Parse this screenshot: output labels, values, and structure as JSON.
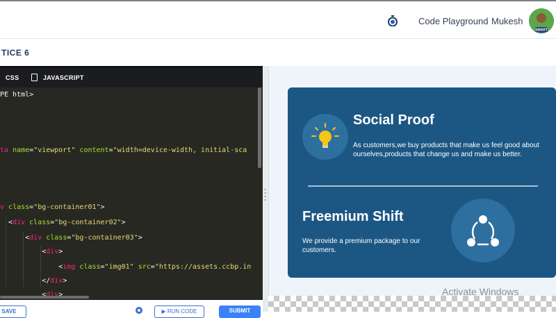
{
  "header": {
    "nav_link": "Code Playground",
    "user_name": "Mukesh",
    "avatar_badge": "SMART"
  },
  "page": {
    "title": "TICE 6"
  },
  "editor": {
    "tabs": [
      "CSS",
      "JAVASCRIPT"
    ],
    "code_lines": [
      [
        {
          "c": "t",
          "v": "PE html>"
        }
      ],
      [],
      [],
      [],
      [
        {
          "c": "g",
          "v": "ta "
        },
        {
          "c": "a",
          "v": "name"
        },
        {
          "c": "t",
          "v": "="
        },
        {
          "c": "s",
          "v": "\"viewport\""
        },
        {
          "c": "t",
          "v": " "
        },
        {
          "c": "a",
          "v": "content"
        },
        {
          "c": "t",
          "v": "="
        },
        {
          "c": "s",
          "v": "\"width=device-width, initial-sca"
        }
      ],
      [],
      [],
      [],
      [
        {
          "c": "g",
          "v": "v "
        },
        {
          "c": "a",
          "v": "class"
        },
        {
          "c": "t",
          "v": "="
        },
        {
          "c": "s",
          "v": "\"bg-container01\""
        },
        {
          "c": "t",
          "v": ">"
        }
      ],
      [
        {
          "c": "t",
          "v": "  <"
        },
        {
          "c": "g",
          "v": "div "
        },
        {
          "c": "a",
          "v": "class"
        },
        {
          "c": "t",
          "v": "="
        },
        {
          "c": "s",
          "v": "\"bg-container02\""
        },
        {
          "c": "t",
          "v": ">"
        }
      ],
      [
        {
          "c": "t",
          "v": "      <"
        },
        {
          "c": "g",
          "v": "div "
        },
        {
          "c": "a",
          "v": "class"
        },
        {
          "c": "t",
          "v": "="
        },
        {
          "c": "s",
          "v": "\"bg-container03\""
        },
        {
          "c": "t",
          "v": ">"
        }
      ],
      [
        {
          "c": "t",
          "v": "          <"
        },
        {
          "c": "g",
          "v": "div"
        },
        {
          "c": "t",
          "v": ">"
        }
      ],
      [
        {
          "c": "t",
          "v": "              <"
        },
        {
          "c": "g",
          "v": "img "
        },
        {
          "c": "a",
          "v": "class"
        },
        {
          "c": "t",
          "v": "="
        },
        {
          "c": "s",
          "v": "\"img01\""
        },
        {
          "c": "t",
          "v": " "
        },
        {
          "c": "a",
          "v": "src"
        },
        {
          "c": "t",
          "v": "="
        },
        {
          "c": "s",
          "v": "\"https://assets.ccbp.in"
        }
      ],
      [
        {
          "c": "t",
          "v": "          </"
        },
        {
          "c": "g",
          "v": "div"
        },
        {
          "c": "t",
          "v": ">"
        }
      ],
      [
        {
          "c": "t",
          "v": "          <"
        },
        {
          "c": "g",
          "v": "div"
        },
        {
          "c": "t",
          "v": ">"
        }
      ]
    ],
    "buttons": {
      "save": "SAVE",
      "run": "RUN CODE",
      "submit": "SUBMIT"
    }
  },
  "preview": {
    "section1": {
      "title": "Social Proof",
      "description": "As customers,we buy products that make us feel good about ourselves,products that change us and make us better."
    },
    "section2": {
      "title": "Freemium Shift",
      "description": "We provide a premium package to our customers."
    },
    "watermark": "Activate Windows"
  },
  "colors": {
    "card_bg": "#1c5784",
    "icon_circle": "#2d6f9f",
    "accent": "#3b82f6",
    "editor_bg": "#272822"
  },
  "icons": {
    "header": "stopwatch-icon",
    "bottom": "gear-icon",
    "card1": "lightbulb-icon",
    "card2": "share-icon"
  }
}
